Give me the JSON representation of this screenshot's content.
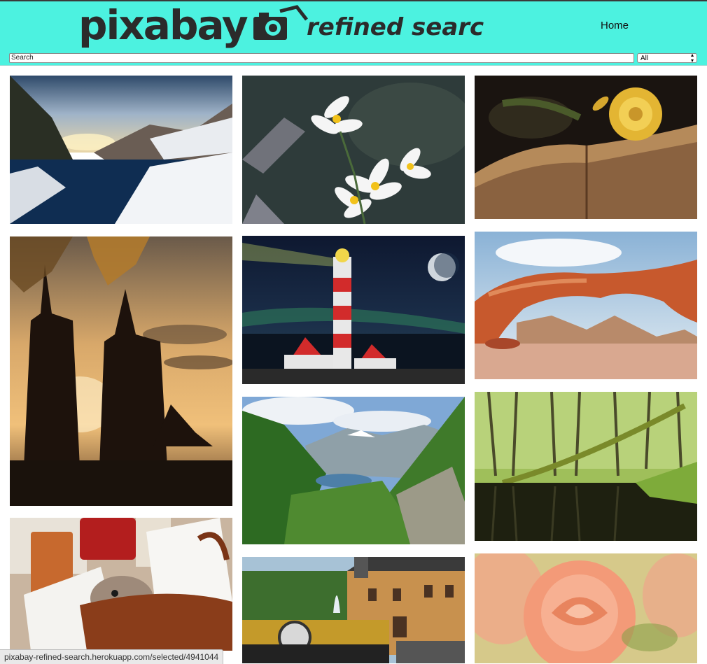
{
  "header": {
    "logo_word": "pixabay",
    "logo_tagline": "refined search",
    "nav_home": "Home",
    "accent_color": "#4cf2e0"
  },
  "search": {
    "placeholder": "Search",
    "value": "",
    "category_selected": "All"
  },
  "gallery": {
    "images": [
      {
        "subject": "snowy mountain lake at sunset"
      },
      {
        "subject": "white star flowers"
      },
      {
        "subject": "yellow rose on open book"
      },
      {
        "subject": "cathedral spires silhouette at sunset"
      },
      {
        "subject": "lighthouse under night sky with aurora"
      },
      {
        "subject": "red sandstone rock arch in desert"
      },
      {
        "subject": "green fjord valley"
      },
      {
        "subject": "trees reflected in forest pond"
      },
      {
        "subject": "hamster in wicker basket with receipt"
      },
      {
        "subject": "vintage car in front of castle with fountain"
      },
      {
        "subject": "peach rose close-up"
      }
    ]
  },
  "status_bar": {
    "url": "pixabay-refined-search.herokuapp.com/selected/4941044"
  }
}
